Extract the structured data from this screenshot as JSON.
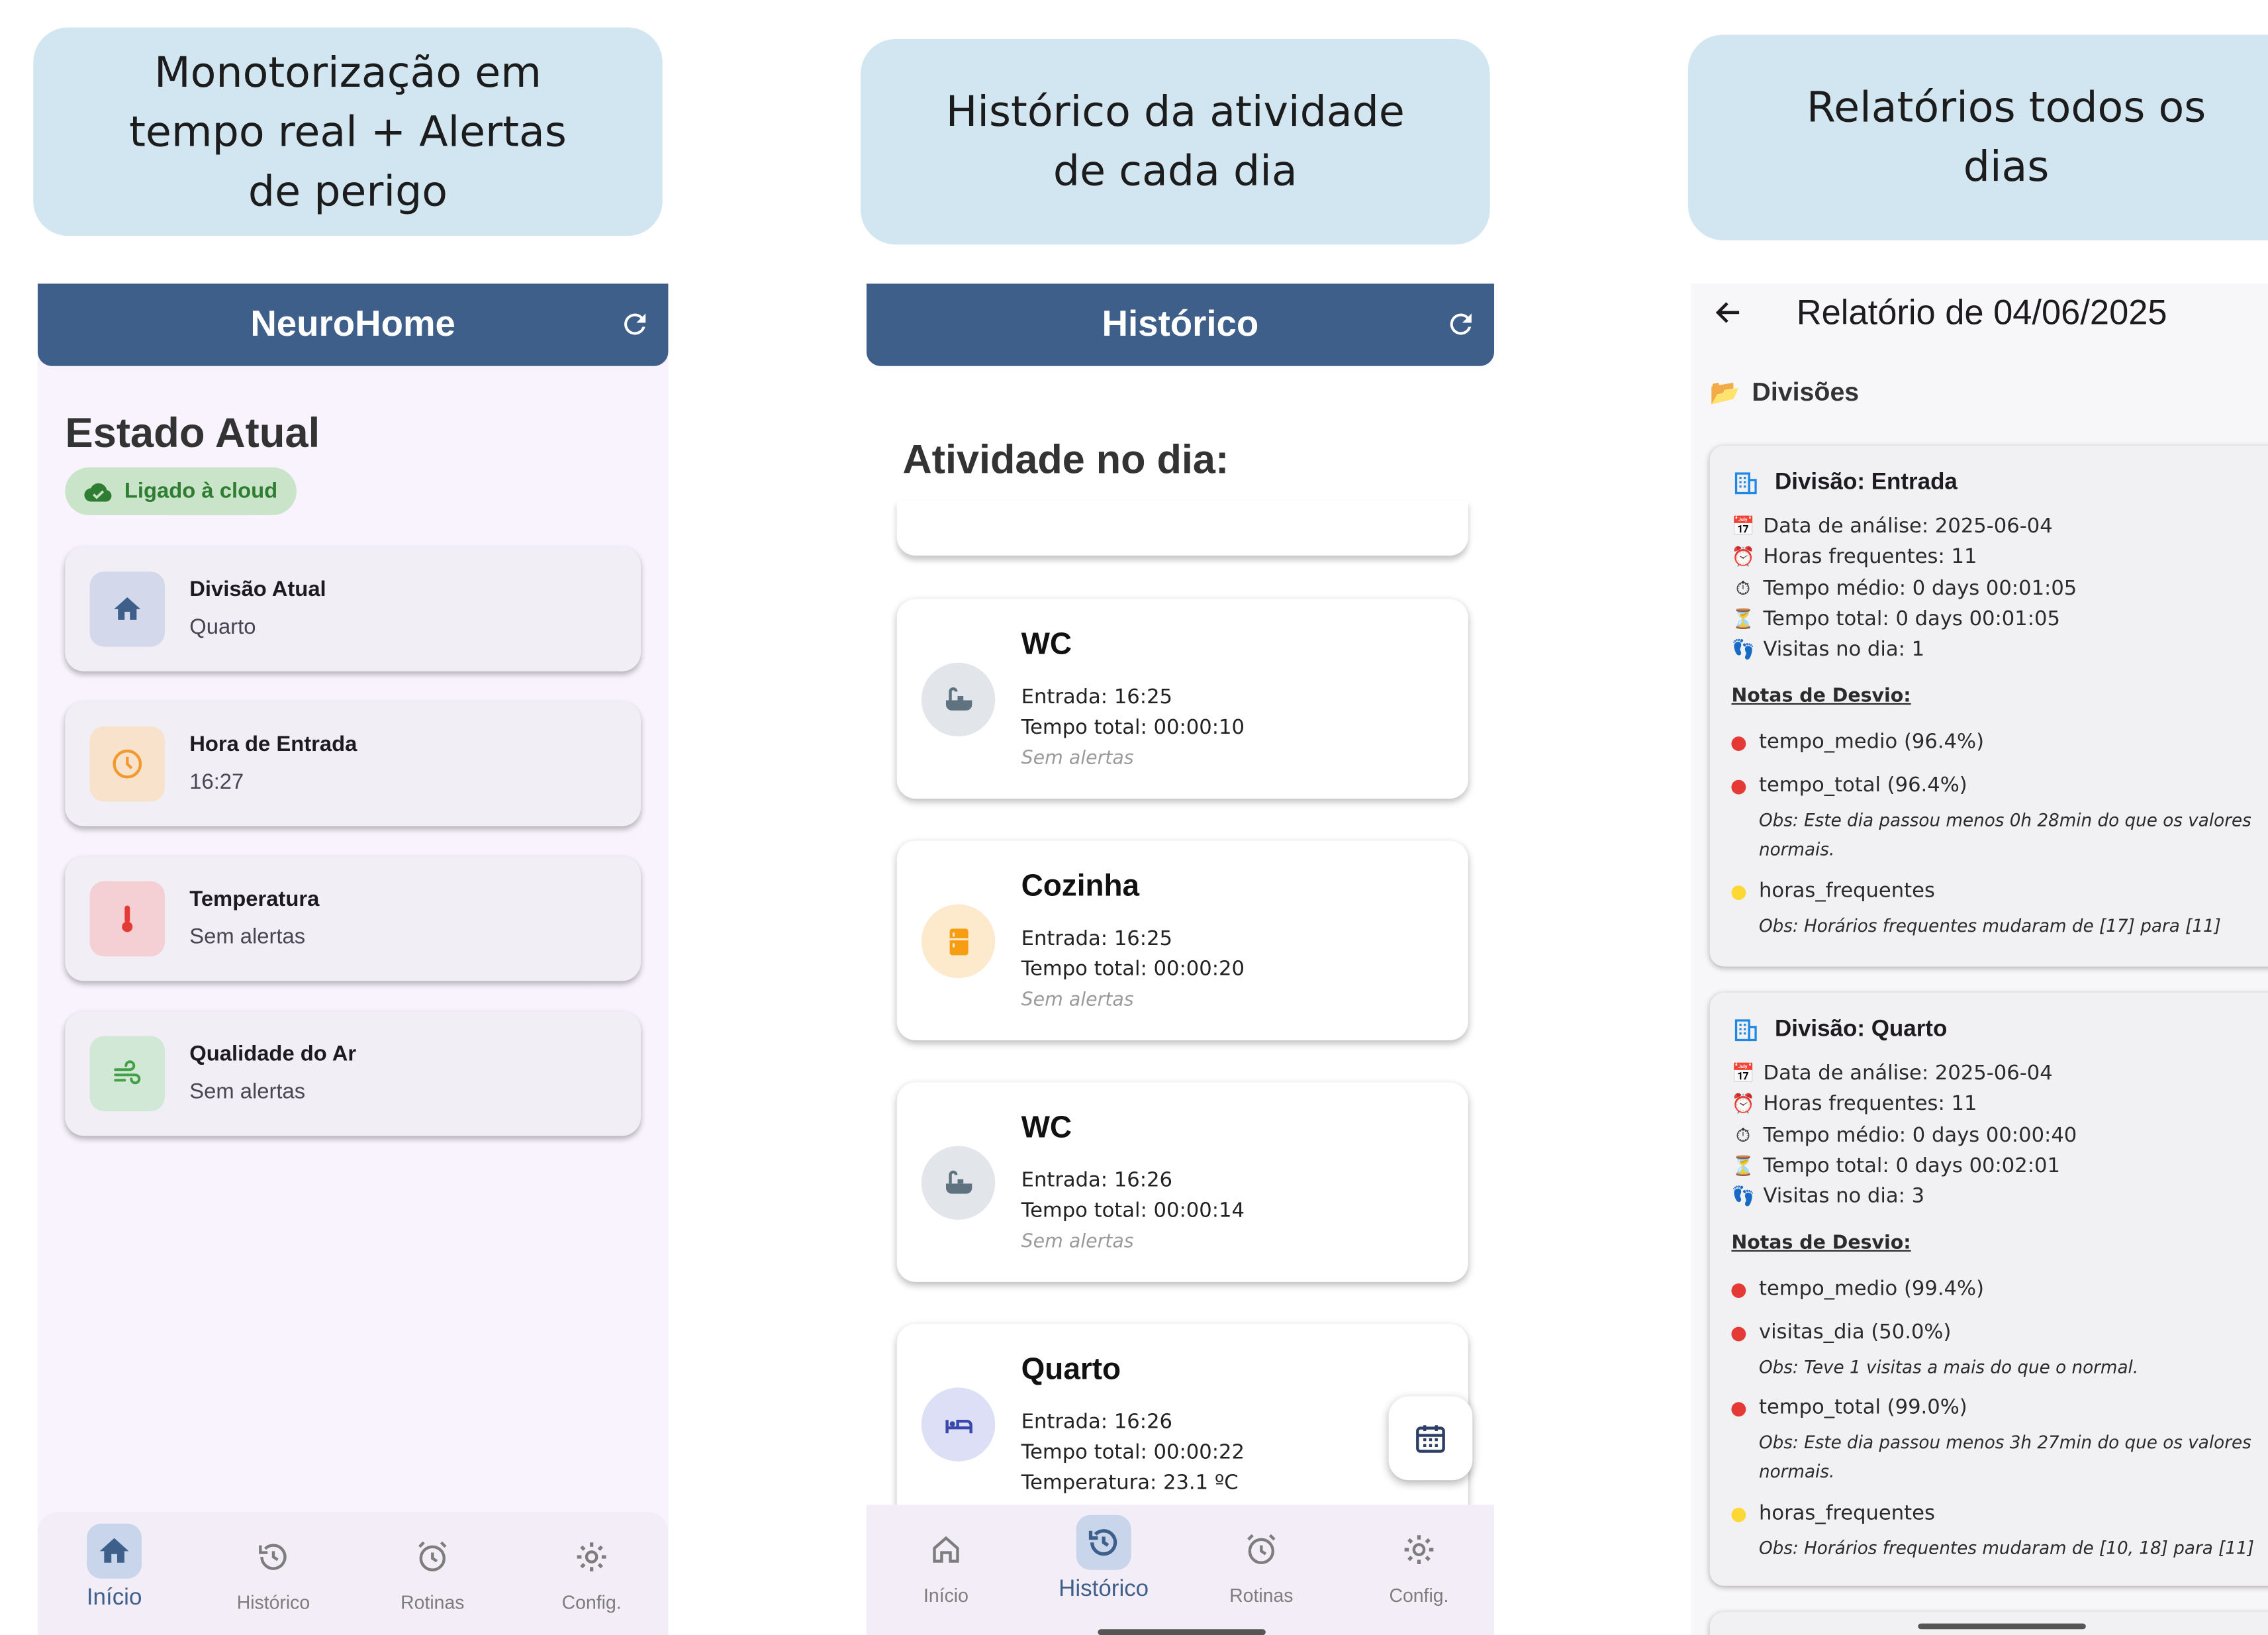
{
  "captions": [
    "Monotorização em\ntempo real + Alertas\nde perigo",
    "Histórico da atividade\nde cada dia",
    "Relatórios todos os\ndias"
  ],
  "home": {
    "title": "NeuroHome",
    "heading": "Estado Atual",
    "badge": "Ligado à cloud",
    "cards": [
      {
        "title": "Divisão Atual",
        "value": "Quarto",
        "icon": "home-icon",
        "bg": "#d3d9ea",
        "fg": "#3e5f8a"
      },
      {
        "title": "Hora de Entrada",
        "value": "16:27",
        "icon": "clock-icon",
        "bg": "#f8e2cb",
        "fg": "#f29a2e"
      },
      {
        "title": "Temperatura",
        "value": "Sem alertas",
        "icon": "thermometer-icon",
        "bg": "#f4cfd3",
        "fg": "#e53935"
      },
      {
        "title": "Qualidade do Ar",
        "value": "Sem alertas",
        "icon": "air-icon",
        "bg": "#d2e8d6",
        "fg": "#43a047"
      }
    ],
    "nav": [
      "Início",
      "Histórico",
      "Rotinas",
      "Config."
    ]
  },
  "history": {
    "title": "Histórico",
    "heading": "Atividade no dia:",
    "entries": [
      {
        "room": "WC",
        "entry": "Entrada: 16:25",
        "total": "Tempo total: 00:00:10",
        "status": "Sem alertas",
        "icon": "bathtub-icon"
      },
      {
        "room": "Cozinha",
        "entry": "Entrada: 16:25",
        "total": "Tempo total: 00:00:20",
        "status": "Sem alertas",
        "icon": "fridge-icon"
      },
      {
        "room": "WC",
        "entry": "Entrada: 16:26",
        "total": "Tempo total: 00:00:14",
        "status": "Sem alertas",
        "icon": "bathtub-icon"
      },
      {
        "room": "Quarto",
        "entry": "Entrada: 16:26",
        "total": "Tempo total: 00:00:22",
        "temp": "Temperatura: 23.1 ºC",
        "icon": "bed-icon"
      }
    ],
    "nav": [
      "Início",
      "Histórico",
      "Rotinas",
      "Config."
    ]
  },
  "report": {
    "title": "Relatório de 04/06/2025",
    "section": "Divisões",
    "notes_label": "Notas de Desvio:",
    "divisions": [
      {
        "name": "Divisão: Entrada",
        "lines": [
          "Data de análise: 2025-06-04",
          "Horas frequentes: 11",
          "Tempo médio: 0 days 00:01:05",
          "Tempo total: 0 days 00:01:05",
          "Visitas no dia: 1"
        ],
        "notes": [
          {
            "label": "tempo_medio (96.4%)",
            "color": "#e53935"
          },
          {
            "label": "tempo_total (96.4%)",
            "color": "#e53935",
            "obs": "Obs: Este dia passou menos 0h 28min do que os valores normais."
          },
          {
            "label": "horas_frequentes",
            "color": "#fdd835",
            "obs": "Obs: Horários frequentes mudaram de [17] para [11]"
          }
        ]
      },
      {
        "name": "Divisão: Quarto",
        "lines": [
          "Data de análise: 2025-06-04",
          "Horas frequentes: 11",
          "Tempo médio: 0 days 00:00:40",
          "Tempo total: 0 days 00:02:01",
          "Visitas no dia: 3"
        ],
        "notes": [
          {
            "label": "tempo_medio (99.4%)",
            "color": "#e53935"
          },
          {
            "label": "visitas_dia (50.0%)",
            "color": "#e53935",
            "obs": "Obs: Teve 1 visitas a mais do que o normal."
          },
          {
            "label": "tempo_total (99.0%)",
            "color": "#e53935",
            "obs": "Obs: Este dia passou menos 3h 27min do que os valores normais."
          },
          {
            "label": "horas_frequentes",
            "color": "#fdd835",
            "obs": "Obs: Horários frequentes mudaram de [10, 18] para [11]"
          }
        ]
      }
    ],
    "line_icons": [
      "📅",
      "⏰",
      "⏱️",
      "⏳",
      "👣"
    ]
  }
}
